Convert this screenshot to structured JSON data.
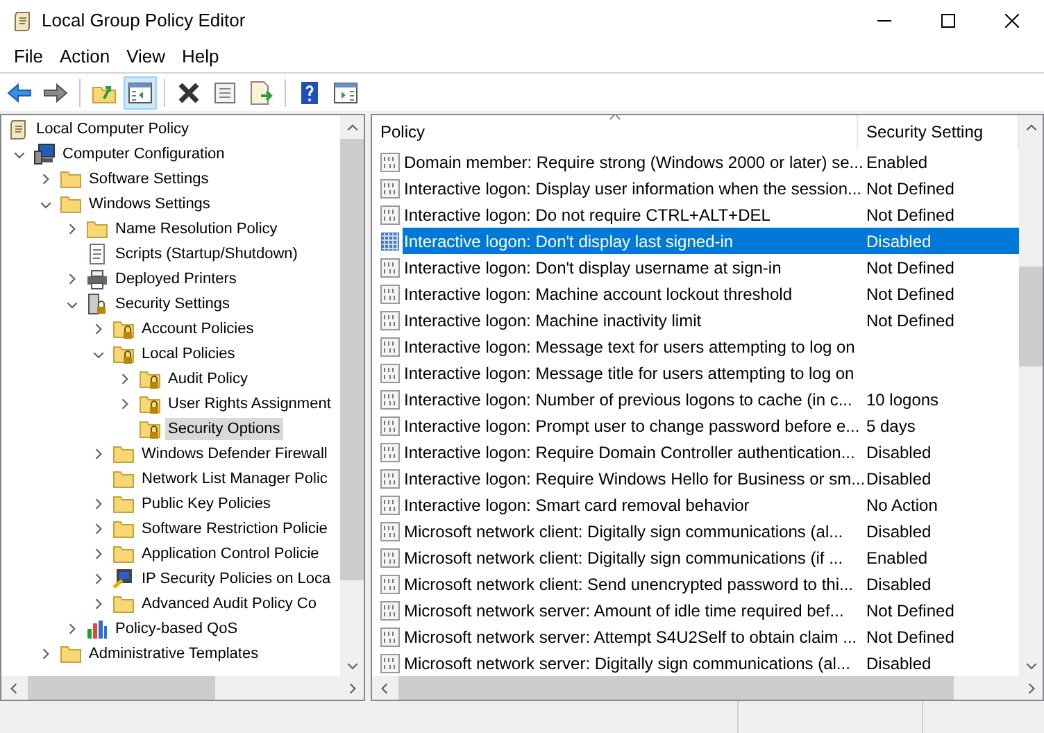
{
  "window": {
    "title": "Local Group Policy Editor"
  },
  "menu": [
    {
      "label": "File"
    },
    {
      "label": "Action"
    },
    {
      "label": "View"
    },
    {
      "label": "Help"
    }
  ],
  "toolbar": [
    {
      "kind": "back",
      "pressed": false
    },
    {
      "kind": "forward",
      "pressed": false
    },
    {
      "kind": "separator"
    },
    {
      "kind": "up",
      "pressed": false
    },
    {
      "kind": "console-tree",
      "pressed": true
    },
    {
      "kind": "separator"
    },
    {
      "kind": "delete",
      "pressed": false
    },
    {
      "kind": "properties",
      "pressed": false
    },
    {
      "kind": "export",
      "pressed": false
    },
    {
      "kind": "separator"
    },
    {
      "kind": "help",
      "pressed": false
    },
    {
      "kind": "action-pane",
      "pressed": false
    }
  ],
  "tree": [
    {
      "label": "Local Computer Policy",
      "kind": "scroll",
      "selected": false,
      "children": [
        {
          "label": "Computer Configuration",
          "kind": "computer",
          "expanded": true,
          "selected": false,
          "children": [
            {
              "label": "Software Settings",
              "kind": "folder",
              "expanded": false,
              "selected": false
            },
            {
              "label": "Windows Settings",
              "kind": "folder",
              "expanded": true,
              "selected": false,
              "children": [
                {
                  "label": "Name Resolution Policy",
                  "kind": "folder",
                  "expanded": false,
                  "selected": false
                },
                {
                  "label": "Scripts (Startup/Shutdown)",
                  "kind": "script",
                  "selected": false
                },
                {
                  "label": "Deployed Printers",
                  "kind": "printer",
                  "expanded": false,
                  "selected": false
                },
                {
                  "label": "Security Settings",
                  "kind": "security",
                  "expanded": true,
                  "selected": false,
                  "children": [
                    {
                      "label": "Account Policies",
                      "kind": "locked-folder",
                      "expanded": false,
                      "selected": false
                    },
                    {
                      "label": "Local Policies",
                      "kind": "locked-folder",
                      "expanded": true,
                      "selected": false,
                      "children": [
                        {
                          "label": "Audit Policy",
                          "kind": "locked-folder",
                          "expanded": false,
                          "selected": false
                        },
                        {
                          "label": "User Rights Assignment",
                          "kind": "locked-folder",
                          "expanded": false,
                          "selected": false
                        },
                        {
                          "label": "Security Options",
                          "kind": "locked-folder",
                          "selected": true
                        }
                      ]
                    },
                    {
                      "label": "Windows Defender Firewall",
                      "kind": "folder",
                      "expanded": false,
                      "selected": false
                    },
                    {
                      "label": "Network List Manager Polic",
                      "kind": "folder",
                      "selected": false
                    },
                    {
                      "label": "Public Key Policies",
                      "kind": "folder",
                      "expanded": false,
                      "selected": false
                    },
                    {
                      "label": "Software Restriction Policie",
                      "kind": "folder",
                      "expanded": false,
                      "selected": false
                    },
                    {
                      "label": "Application Control Policie",
                      "kind": "folder",
                      "expanded": false,
                      "selected": false
                    },
                    {
                      "label": "IP Security Policies on Loca",
                      "kind": "ip-security",
                      "expanded": false,
                      "selected": false
                    },
                    {
                      "label": "Advanced Audit Policy Co",
                      "kind": "folder",
                      "expanded": false,
                      "selected": false
                    }
                  ]
                },
                {
                  "label": "Policy-based QoS",
                  "kind": "chart",
                  "expanded": false,
                  "selected": false
                }
              ]
            },
            {
              "label": "Administrative Templates",
              "kind": "folder",
              "expanded": false,
              "selected": false
            }
          ]
        }
      ]
    }
  ],
  "table": {
    "columns": [
      {
        "label": "Policy",
        "sorted": true
      },
      {
        "label": "Security Setting",
        "sorted": false
      }
    ],
    "rows": [
      {
        "policy": "Domain member: Require strong (Windows 2000 or later) se...",
        "setting": "Enabled",
        "selected": false
      },
      {
        "policy": "Interactive logon: Display user information when the session...",
        "setting": "Not Defined",
        "selected": false
      },
      {
        "policy": "Interactive logon: Do not require CTRL+ALT+DEL",
        "setting": "Not Defined",
        "selected": false
      },
      {
        "policy": "Interactive logon: Don't display last signed-in",
        "setting": "Disabled",
        "selected": true
      },
      {
        "policy": "Interactive logon: Don't display username at sign-in",
        "setting": "Not Defined",
        "selected": false
      },
      {
        "policy": "Interactive logon: Machine account lockout threshold",
        "setting": "Not Defined",
        "selected": false
      },
      {
        "policy": "Interactive logon: Machine inactivity limit",
        "setting": "Not Defined",
        "selected": false
      },
      {
        "policy": "Interactive logon: Message text for users attempting to log on",
        "selected": false
      },
      {
        "policy": "Interactive logon: Message title for users attempting to log on",
        "selected": false
      },
      {
        "policy": "Interactive logon: Number of previous logons to cache (in c...",
        "setting": "10 logons",
        "selected": false
      },
      {
        "policy": "Interactive logon: Prompt user to change password before e...",
        "setting": "5 days",
        "selected": false
      },
      {
        "policy": "Interactive logon: Require Domain Controller authentication...",
        "setting": "Disabled",
        "selected": false
      },
      {
        "policy": "Interactive logon: Require Windows Hello for Business or sm...",
        "setting": "Disabled",
        "selected": false
      },
      {
        "policy": "Interactive logon: Smart card removal behavior",
        "setting": "No Action",
        "selected": false
      },
      {
        "policy": "Microsoft network client: Digitally sign communications (al...",
        "setting": "Disabled",
        "selected": false
      },
      {
        "policy": "Microsoft network client: Digitally sign communications (if ...",
        "setting": "Enabled",
        "selected": false
      },
      {
        "policy": "Microsoft network client: Send unencrypted password to thi...",
        "setting": "Disabled",
        "selected": false
      },
      {
        "policy": "Microsoft network server: Amount of idle time required bef...",
        "setting": "Not Defined",
        "selected": false
      },
      {
        "policy": "Microsoft network server: Attempt S4U2Self to obtain claim ...",
        "setting": "Not Defined",
        "selected": false
      },
      {
        "policy": "Microsoft network server: Digitally sign communications (al...",
        "setting": "Disabled",
        "selected": false
      }
    ]
  }
}
